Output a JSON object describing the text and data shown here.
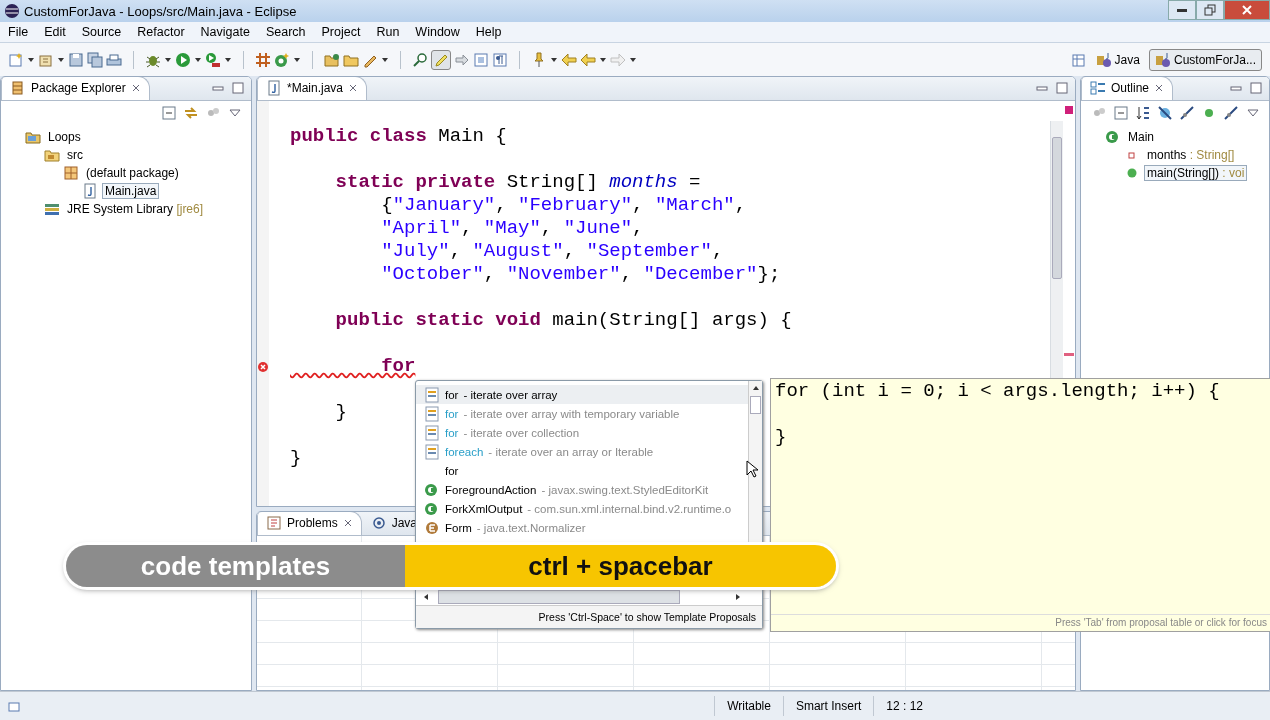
{
  "window": {
    "title": "CustomForJava - Loops/src/Main.java - Eclipse"
  },
  "menu": [
    "File",
    "Edit",
    "Source",
    "Refactor",
    "Navigate",
    "Search",
    "Project",
    "Run",
    "Window",
    "Help"
  ],
  "perspectives": [
    {
      "label": "Java",
      "selected": false
    },
    {
      "label": "CustomForJa...",
      "selected": true
    }
  ],
  "package_explorer": {
    "title": "Package Explorer",
    "tree": [
      {
        "label": "Loops",
        "kind": "project",
        "selected": false,
        "children": [
          {
            "label": "src",
            "kind": "folder",
            "selected": false,
            "children": [
              {
                "label": "(default package)",
                "kind": "package",
                "selected": false,
                "children": [
                  {
                    "label": "Main.java",
                    "kind": "file",
                    "selected": true
                  }
                ]
              }
            ]
          },
          {
            "label": "JRE System Library",
            "decoration": "[jre6]",
            "kind": "library",
            "selected": false
          }
        ]
      }
    ]
  },
  "editor": {
    "tab": "*Main.java",
    "lines": [
      {
        "error": false,
        "tokens": [
          {
            "kind": "keyword",
            "text": "public class "
          },
          {
            "kind": "plain",
            "text": "Main {"
          }
        ]
      },
      {
        "error": false
      },
      {
        "error": false,
        "tokens": [
          {
            "kind": "keyword",
            "text": "    static private "
          },
          {
            "kind": "plain",
            "text": "String[] "
          },
          {
            "kind": "field",
            "text": "months"
          },
          {
            "kind": "plain",
            "text": " ="
          }
        ]
      },
      {
        "error": false,
        "tokens": [
          {
            "kind": "plain",
            "text": "        {"
          },
          {
            "kind": "string",
            "text": "\"January\""
          },
          {
            "kind": "plain",
            "text": ", "
          },
          {
            "kind": "string",
            "text": "\"February\""
          },
          {
            "kind": "plain",
            "text": ", "
          },
          {
            "kind": "string",
            "text": "\"March\""
          },
          {
            "kind": "plain",
            "text": ","
          }
        ]
      },
      {
        "error": false,
        "tokens": [
          {
            "kind": "string",
            "text": "        \"April\""
          },
          {
            "kind": "plain",
            "text": ", "
          },
          {
            "kind": "string",
            "text": "\"May\""
          },
          {
            "kind": "plain",
            "text": ", "
          },
          {
            "kind": "string",
            "text": "\"June\""
          },
          {
            "kind": "plain",
            "text": ","
          }
        ]
      },
      {
        "error": false,
        "tokens": [
          {
            "kind": "string",
            "text": "        \"July\""
          },
          {
            "kind": "plain",
            "text": ", "
          },
          {
            "kind": "string",
            "text": "\"August\""
          },
          {
            "kind": "plain",
            "text": ", "
          },
          {
            "kind": "string",
            "text": "\"September\""
          },
          {
            "kind": "plain",
            "text": ","
          }
        ]
      },
      {
        "error": false,
        "tokens": [
          {
            "kind": "string",
            "text": "        \"October\""
          },
          {
            "kind": "plain",
            "text": ", "
          },
          {
            "kind": "string",
            "text": "\"November\""
          },
          {
            "kind": "plain",
            "text": ", "
          },
          {
            "kind": "string",
            "text": "\"December\""
          },
          {
            "kind": "plain",
            "text": "};"
          }
        ]
      },
      {
        "error": false
      },
      {
        "error": false,
        "tokens": [
          {
            "kind": "keyword",
            "text": "    public static void "
          },
          {
            "kind": "plain",
            "text": "main(String[] args) {"
          }
        ]
      },
      {
        "error": false
      },
      {
        "error": true,
        "tokens": [
          {
            "kind": "keyword",
            "text": "        for"
          }
        ]
      },
      {
        "error": false
      },
      {
        "error": false,
        "tokens": [
          {
            "kind": "plain",
            "text": "    }"
          }
        ]
      },
      {
        "error": false
      },
      {
        "error": false,
        "tokens": [
          {
            "kind": "plain",
            "text": "}"
          }
        ]
      }
    ]
  },
  "content_assist": {
    "proposals": [
      {
        "kind": "template",
        "name": "for",
        "detail": "- iterate over array",
        "selected": true
      },
      {
        "kind": "template",
        "name": "for",
        "detail": "- iterate over array with temporary variable",
        "selected": false
      },
      {
        "kind": "template",
        "name": "for",
        "detail": "- iterate over collection",
        "selected": false
      },
      {
        "kind": "template",
        "name": "foreach",
        "detail": "- iterate over an array or Iterable",
        "selected": false
      },
      {
        "kind": "keyword",
        "name": "for",
        "selected": false
      },
      {
        "kind": "class",
        "name": "ForegroundAction",
        "detail": "- javax.swing.text.StyledEditorKit",
        "selected": false
      },
      {
        "kind": "class",
        "name": "ForkXmlOutput",
        "detail": "- com.sun.xml.internal.bind.v2.runtime.o",
        "selected": false
      },
      {
        "kind": "enum",
        "name": "Form",
        "detail": "- java.text.Normalizer",
        "selected": false
      }
    ],
    "footer": "Press 'Ctrl-Space' to show Template Proposals"
  },
  "template_preview": {
    "code": "for (int i = 0; i < args.length; i++) {\n\n}",
    "footer": "Press 'Tab' from proposal table or click for focus"
  },
  "bottom_panel": {
    "tabs": [
      {
        "label": "Problems",
        "selected": true
      },
      {
        "label": "Java",
        "selected": false
      }
    ]
  },
  "outline": {
    "title": "Outline",
    "tree": [
      {
        "label": "Main",
        "kind": "class",
        "selected": false,
        "children": [
          {
            "label": "months",
            "type": " : String[]",
            "kind": "field",
            "selected": false
          },
          {
            "label": "main(String[])",
            "type": " : voi",
            "kind": "method",
            "selected": true
          }
        ]
      }
    ]
  },
  "status_bar": [
    "Writable",
    "Smart Insert",
    "12 : 12"
  ],
  "caption": {
    "topic": "code templates",
    "shortcut": "ctrl + spacebar"
  }
}
